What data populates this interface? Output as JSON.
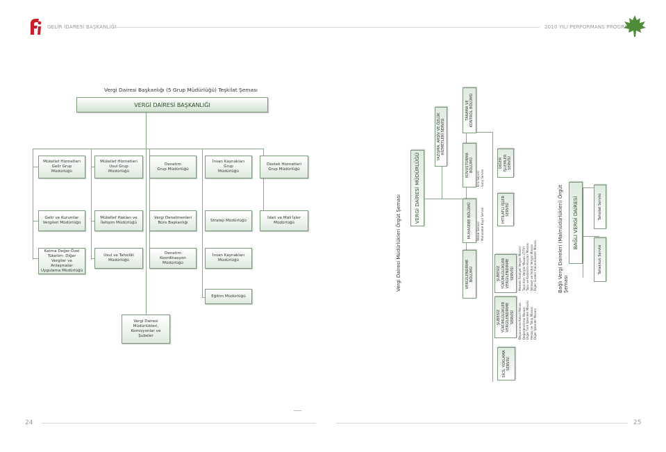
{
  "header": {
    "left_title": "GELİR İDARESİ BAŞKANLIĞI",
    "right_title": "2010 YILI PERFORMANS PROGRAMI",
    "logo_colors": {
      "red": "#c8202a",
      "green": "#4f8c3a"
    }
  },
  "left_chart": {
    "title": "Vergi Dairesi Başkanlığı (5 Grup Müdürlüğü) Teşkilat Şeması",
    "root": "VERGİ DAİRESİ BAŞKANLIĞI",
    "groups": [
      "Mükellef Hizmetleri\nGelir Grup\nMüdürlüğü",
      "Mükellef Hizmetleri\nUsul Grup\nMüdürlüğü",
      "Denetim\nGrup Müdürlüğü",
      "İnsan Kaynakları\nGrup\nMüdürlüğü",
      "Destek Hizmetleri\nGrup Müdürlüğü"
    ],
    "row2": [
      "Gelir ve Kurumlar\nVergileri Müdürlüğü",
      "Mükellef Hakları ve\nİletişim Müdürlüğü",
      "Vergi Denetmenleri\nBüro Başkanlığı",
      "Strateji Müdürlüğü",
      "İdari ve Mali İşler\nMüdürlüğü"
    ],
    "row3": [
      "Katma Değer-Özel\nTüketim- Diğer\nVergiler ve Anlaşmalar\nUygulama Müdürlüğü",
      "Usul ve Tahsilât\nMüdürlüğü",
      "Denetim Koordinasyon\nMüdürlüğü",
      "İnsan Kaynakları\nMüdürlüğü"
    ],
    "row4": "Eğitim Müdürlüğü",
    "bottom": "Vergi Dairesi\nMüdürlükleri,\nKomisyonlar ve\nŞubeler"
  },
  "right_chart": {
    "title": "Vergi Dairesi Müdürlükleri Örgüt Şeması",
    "root": "VERGİ DAİRESİ MÜDÜRLÜĞÜ",
    "top_unit": "YAZIŞMA, ARŞİV VE ÖZLÜK\nHİZMETLERİ SERVİSİ",
    "units": [
      "TARAMA VE\nKONTROL BÖLÜMÜ",
      "KOVUŞTURMA\nBÖLÜMÜ",
      "MUHASEBE BÖLÜMÜ",
      "VERGİLENDİRME\nBÖLÜMÜ"
    ],
    "kovusturma_list": "- İcra Servisi\n- Satış Servisi",
    "muhasebe_list": "- Vezne Servisi\n- Muhasebe Kayıt Servisi",
    "services": [
      "DİĞER İŞLEMLER\nSERVİSİ",
      "İHTİLAFLI İŞLER\nSERVİSİ",
      "ŞUBESİZ\nYÜKÜMLÜLÜKLER\nVERGİLENDİRME\nSERVİSİ",
      "ŞUBESİZ\nYÜKÜMLÜLÜKLER\nVERGİLENDİRME\nSERVİSİ",
      "SİCİL YOKLAMA\nSERVİSİ"
    ],
    "list_a": "- Mesleki Faaliyet Vergisi Masası\n- Taşıt Alım Vergisi Masası (ÖTV)\n- Tapu ve Kadastro Harçları Masası\n- Veraset ve İntikal Vergisi Masası\n- Diğer Sürekli Yükümlülükler Masası",
    "list_b": "- Beyanname Kabul Masası\n- Değerlendirme Masası\n- Diğer Tarh İşlemleri Masası\n- Hesap ve Takip Masası\n- Diğer İşlemler Masası",
    "sub_title": "Bağlı Vergi Daireleri (Malmüdürlükleri) Örgüt Şeması",
    "sub_root": "BAĞLI VERGİ DAİRESİ",
    "sub_units": [
      "Tahsilat Servisi",
      "Tahakkuk Servisi"
    ]
  },
  "footer": {
    "left_page": "24",
    "right_page": "25"
  }
}
